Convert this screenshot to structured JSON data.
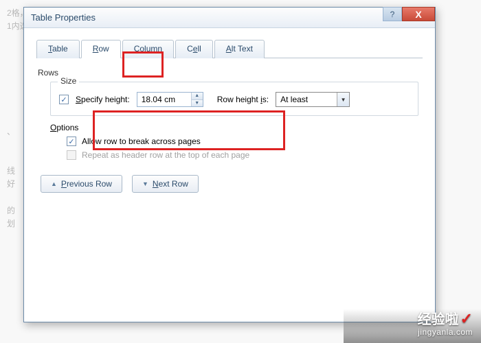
{
  "dialog": {
    "title": "Table Properties",
    "tabs": {
      "table": "Table",
      "row": "Row",
      "column": "Column",
      "cell": "Cell",
      "alt_text": "Alt Text"
    },
    "rows_label": "Rows",
    "size": {
      "legend": "Size",
      "specify_height_label": "Specify height:",
      "specify_height_checked": true,
      "height_value": "18.04 cm",
      "row_height_is_label": "Row height is:",
      "row_height_is_value": "At least"
    },
    "options": {
      "legend": "Options",
      "allow_break_label": "Allow row to break across pages",
      "allow_break_checked": true,
      "repeat_header_label": "Repeat as header row at the top of each page",
      "repeat_header_enabled": false
    },
    "nav": {
      "previous": "Previous Row",
      "next": "Next Row"
    }
  },
  "watermark": {
    "brand": "经验啦",
    "url": "jingyanla.com"
  }
}
